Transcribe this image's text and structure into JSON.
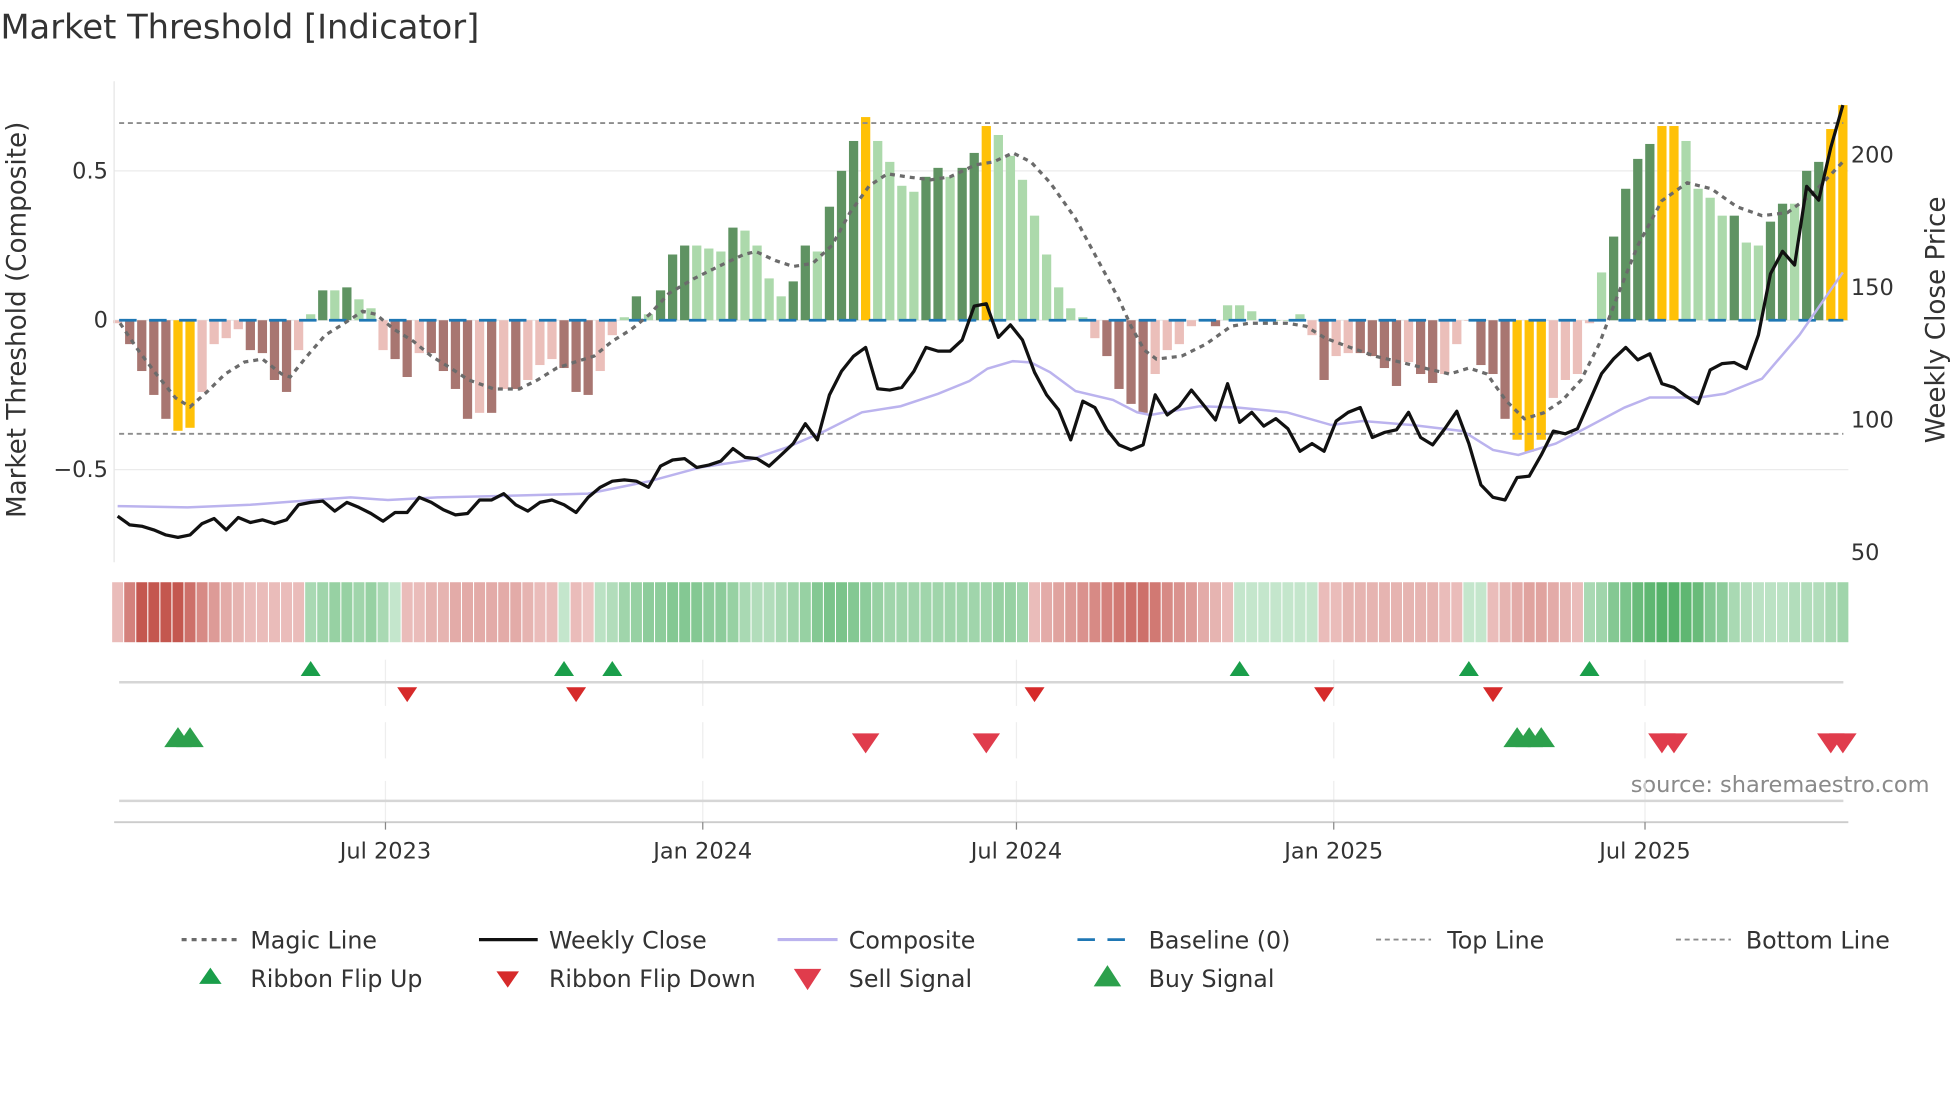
{
  "chart_data": {
    "type": "bar",
    "title": "Market Threshold [Indicator]",
    "ylabel": "Market Threshold (Composite)",
    "y2label": "Weekly Close Price",
    "source": "source: sharemaestro.com",
    "ylim": [
      -0.81,
      0.8
    ],
    "y2lim": [
      45.8,
      227.4
    ],
    "yticks": [
      {
        "value": 0.5,
        "label": "0.5"
      },
      {
        "value": 0,
        "label": "0"
      },
      {
        "value": -0.5,
        "label": "−0.5"
      }
    ],
    "y2ticks": [
      {
        "value": 200,
        "label": "200"
      },
      {
        "value": 150,
        "label": "150"
      },
      {
        "value": 100,
        "label": "100"
      },
      {
        "value": 50,
        "label": "50"
      }
    ],
    "xticks": [
      {
        "week": 22.2,
        "label": "Jul 2023"
      },
      {
        "week": 48.5,
        "label": "Jan 2024"
      },
      {
        "week": 74.5,
        "label": "Jul 2024"
      },
      {
        "week": 100.8,
        "label": "Jan 2025"
      },
      {
        "week": 126.6,
        "label": "Jul 2025"
      }
    ],
    "top_line": 0.66,
    "bottom_line": -0.38,
    "baseline": 0,
    "colors": {
      "G": "#5f9362",
      "g": "#acd9ab",
      "R": "#a87671",
      "r": "#ebbfba",
      "Y": "#ffc107",
      "magic": "#6b6b6b",
      "close": "#111111",
      "composite": "#bbb3ee",
      "baseline": "#1f77b4",
      "threshold": "#8c8c8c",
      "flip_up": "#1a9e4a",
      "flip_down": "#d62a2a",
      "buy": "#2ca04c",
      "sell": "#e03c4c"
    },
    "bars": [
      -0.01,
      -0.08,
      -0.17,
      -0.25,
      -0.33,
      -0.37,
      -0.36,
      -0.24,
      -0.08,
      -0.06,
      -0.03,
      -0.1,
      -0.11,
      -0.2,
      -0.24,
      -0.1,
      0.02,
      0.1,
      0.1,
      0.11,
      0.07,
      0.04,
      -0.1,
      -0.13,
      -0.19,
      -0.11,
      -0.11,
      -0.17,
      -0.23,
      -0.33,
      -0.31,
      -0.31,
      -0.23,
      -0.23,
      -0.2,
      -0.15,
      -0.13,
      -0.16,
      -0.24,
      -0.25,
      -0.17,
      -0.05,
      0.01,
      0.08,
      0.02,
      0.1,
      0.22,
      0.25,
      0.25,
      0.24,
      0.23,
      0.31,
      0.3,
      0.25,
      0.14,
      0.08,
      0.13,
      0.25,
      0.23,
      0.38,
      0.5,
      0.6,
      0.68,
      0.6,
      0.53,
      0.45,
      0.43,
      0.48,
      0.51,
      0.48,
      0.51,
      0.56,
      0.65,
      0.62,
      0.55,
      0.47,
      0.35,
      0.22,
      0.11,
      0.04,
      0.01,
      -0.06,
      -0.12,
      -0.23,
      -0.28,
      -0.31,
      -0.18,
      -0.1,
      -0.08,
      -0.02,
      0.0,
      -0.02,
      0.05,
      0.05,
      0.03,
      0.0,
      0.0,
      0.0,
      0.02,
      -0.05,
      -0.2,
      -0.12,
      -0.11,
      -0.11,
      -0.12,
      -0.16,
      -0.22,
      -0.14,
      -0.18,
      -0.21,
      -0.18,
      -0.08,
      0.0,
      -0.15,
      -0.18,
      -0.33,
      -0.4,
      -0.44,
      -0.4,
      -0.26,
      -0.2,
      -0.18,
      -0.01,
      0.16,
      0.28,
      0.44,
      0.54,
      0.59,
      0.65,
      0.65,
      0.6,
      0.44,
      0.41,
      0.35,
      0.35,
      0.26,
      0.25,
      0.33,
      0.39,
      0.39,
      0.5,
      0.53,
      0.64,
      0.72
    ],
    "bar_classes": "rRRRRYYrrrrRRRRrgGgGggrRRrRRRRrRrRrrrRRRrrgGgGGGgggGggggGGgGGGYggggGGgGGYggggggggrRRRRrrrrrRgggggggrRrrRRRRrRRrrrRRRYYYrrrrgGGGGYYggggGggGGgGGYY",
    "weekly_close": [
      63.2,
      59.9,
      59.4,
      58.0,
      56.1,
      55.2,
      56.1,
      60.4,
      62.3,
      58.0,
      62.7,
      60.8,
      61.8,
      60.4,
      61.8,
      67.5,
      68.4,
      68.9,
      65.1,
      68.4,
      66.5,
      64.2,
      61.3,
      64.6,
      64.6,
      70.3,
      68.4,
      65.6,
      63.7,
      64.2,
      69.3,
      69.3,
      71.7,
      67.5,
      65.1,
      68.4,
      69.3,
      67.5,
      64.6,
      70.3,
      74.1,
      76.4,
      76.9,
      76.4,
      74.1,
      82.1,
      84.4,
      84.9,
      81.6,
      82.5,
      84.0,
      88.7,
      85.4,
      84.9,
      82.1,
      86.3,
      90.6,
      98.1,
      92.0,
      109.0,
      117.9,
      123.6,
      126.9,
      111.3,
      110.8,
      111.8,
      117.9,
      126.9,
      125.5,
      125.5,
      129.7,
      142.5,
      143.4,
      130.7,
      135.4,
      129.7,
      117.5,
      109.0,
      103.3,
      92.0,
      106.6,
      104.2,
      95.8,
      90.1,
      88.2,
      90.1,
      109.0,
      101.4,
      104.7,
      110.8,
      105.2,
      99.5,
      113.2,
      98.6,
      102.4,
      97.2,
      100.0,
      96.2,
      87.7,
      90.6,
      87.7,
      99.1,
      102.4,
      104.2,
      92.9,
      94.8,
      95.8,
      102.4,
      92.9,
      90.1,
      96.2,
      102.8,
      90.6,
      75.0,
      70.3,
      69.3,
      77.8,
      78.3,
      86.3,
      95.3,
      94.3,
      96.2,
      106.6,
      117.0,
      122.6,
      126.9,
      122.2,
      124.5,
      113.2,
      111.8,
      108.5,
      105.7,
      118.4,
      120.8,
      121.2,
      118.9,
      131.6,
      154.7,
      163.2,
      158.0,
      187.7,
      182.5,
      202.4,
      218.4
    ],
    "composite": [
      [
        0,
        67.0
      ],
      [
        5.8,
        66.5
      ],
      [
        11,
        67.5
      ],
      [
        16.2,
        69.3
      ],
      [
        19.3,
        70.3
      ],
      [
        22.4,
        69.3
      ],
      [
        26.5,
        70.3
      ],
      [
        31.7,
        70.8
      ],
      [
        39,
        71.7
      ],
      [
        44.1,
        76.4
      ],
      [
        48.3,
        81.6
      ],
      [
        52.4,
        84.4
      ],
      [
        55.5,
        89.2
      ],
      [
        58.6,
        95.3
      ],
      [
        61.7,
        102.4
      ],
      [
        64.9,
        104.7
      ],
      [
        68,
        109.4
      ],
      [
        70.6,
        114.2
      ],
      [
        72.1,
        118.9
      ],
      [
        74.2,
        121.7
      ],
      [
        75.7,
        121.2
      ],
      [
        77.3,
        117.5
      ],
      [
        79.4,
        110.4
      ],
      [
        82.5,
        107.1
      ],
      [
        84.5,
        102.4
      ],
      [
        85.6,
        101.4
      ],
      [
        89.7,
        104.7
      ],
      [
        92.8,
        104.2
      ],
      [
        96.9,
        102.4
      ],
      [
        100.6,
        97.6
      ],
      [
        103.2,
        99.1
      ],
      [
        107.3,
        97.6
      ],
      [
        111.5,
        95.3
      ],
      [
        114,
        88.2
      ],
      [
        116.1,
        86.3
      ],
      [
        119.2,
        90.6
      ],
      [
        121.8,
        96.7
      ],
      [
        124.9,
        104.2
      ],
      [
        127,
        108.0
      ],
      [
        131.1,
        108.0
      ],
      [
        133.2,
        109.4
      ],
      [
        136.3,
        115.1
      ],
      [
        139.4,
        131.6
      ],
      [
        143,
        155.2
      ]
    ],
    "magic_line": [
      [
        0.2,
        -0.01
      ],
      [
        1.7,
        -0.1
      ],
      [
        3.2,
        -0.18
      ],
      [
        4.8,
        -0.26
      ],
      [
        6.0,
        -0.29
      ],
      [
        7.4,
        -0.24
      ],
      [
        8.9,
        -0.18
      ],
      [
        10.5,
        -0.14
      ],
      [
        12.0,
        -0.13
      ],
      [
        13.6,
        -0.18
      ],
      [
        14.3,
        -0.19
      ],
      [
        15.7,
        -0.12
      ],
      [
        17.2,
        -0.05
      ],
      [
        18.8,
        -0.01
      ],
      [
        20.3,
        0.03
      ],
      [
        21.4,
        0.02
      ],
      [
        22.9,
        -0.03
      ],
      [
        24.5,
        -0.07
      ],
      [
        26.0,
        -0.12
      ],
      [
        27.6,
        -0.16
      ],
      [
        29.1,
        -0.2
      ],
      [
        31.2,
        -0.23
      ],
      [
        33.3,
        -0.23
      ],
      [
        34.8,
        -0.2
      ],
      [
        36.4,
        -0.16
      ],
      [
        37.9,
        -0.14
      ],
      [
        39.5,
        -0.12
      ],
      [
        41.0,
        -0.07
      ],
      [
        42.6,
        -0.03
      ],
      [
        44.1,
        0.02
      ],
      [
        45.7,
        0.09
      ],
      [
        47.8,
        0.14
      ],
      [
        49.8,
        0.18
      ],
      [
        51.9,
        0.22
      ],
      [
        52.9,
        0.23
      ],
      [
        54.5,
        0.2
      ],
      [
        56.0,
        0.18
      ],
      [
        57.6,
        0.19
      ],
      [
        59.2,
        0.25
      ],
      [
        60.7,
        0.36
      ],
      [
        62.3,
        0.45
      ],
      [
        63.8,
        0.49
      ],
      [
        65.4,
        0.48
      ],
      [
        67.4,
        0.47
      ],
      [
        69.0,
        0.48
      ],
      [
        71.1,
        0.52
      ],
      [
        72.6,
        0.53
      ],
      [
        74.2,
        0.56
      ],
      [
        75.7,
        0.53
      ],
      [
        77.3,
        0.46
      ],
      [
        79.4,
        0.34
      ],
      [
        81.4,
        0.19
      ],
      [
        83.0,
        0.07
      ],
      [
        84.0,
        -0.02
      ],
      [
        85.1,
        -0.1
      ],
      [
        86.1,
        -0.13
      ],
      [
        88.2,
        -0.12
      ],
      [
        90.2,
        -0.08
      ],
      [
        92.3,
        -0.02
      ],
      [
        93.8,
        -0.01
      ],
      [
        96.9,
        -0.01
      ],
      [
        98.5,
        -0.02
      ],
      [
        100.1,
        -0.06
      ],
      [
        102.1,
        -0.09
      ],
      [
        104.2,
        -0.12
      ],
      [
        106.3,
        -0.14
      ],
      [
        108.3,
        -0.16
      ],
      [
        110.4,
        -0.18
      ],
      [
        112.0,
        -0.16
      ],
      [
        113.5,
        -0.18
      ],
      [
        115.1,
        -0.27
      ],
      [
        116.6,
        -0.33
      ],
      [
        118.2,
        -0.31
      ],
      [
        119.7,
        -0.27
      ],
      [
        121.3,
        -0.2
      ],
      [
        122.8,
        -0.08
      ],
      [
        124.4,
        0.09
      ],
      [
        126.0,
        0.25
      ],
      [
        128.0,
        0.4
      ],
      [
        130.1,
        0.46
      ],
      [
        132.1,
        0.44
      ],
      [
        134.2,
        0.38
      ],
      [
        136.3,
        0.35
      ],
      [
        138.4,
        0.36
      ],
      [
        140.4,
        0.42
      ],
      [
        143.0,
        0.53
      ]
    ],
    "ribbon": [
      -0.2,
      -0.55,
      -0.8,
      -0.8,
      -0.8,
      -0.8,
      -0.65,
      -0.5,
      -0.4,
      -0.3,
      -0.25,
      -0.2,
      -0.2,
      -0.2,
      -0.2,
      -0.2,
      0.3,
      0.35,
      0.4,
      0.4,
      0.35,
      0.4,
      0.3,
      0.15,
      -0.2,
      -0.2,
      -0.25,
      -0.25,
      -0.3,
      -0.3,
      -0.3,
      -0.3,
      -0.3,
      -0.3,
      -0.25,
      -0.2,
      -0.2,
      0.15,
      -0.2,
      -0.15,
      0.2,
      0.25,
      0.35,
      0.4,
      0.45,
      0.45,
      0.5,
      0.5,
      0.5,
      0.45,
      0.45,
      0.4,
      0.3,
      0.25,
      0.25,
      0.3,
      0.35,
      0.4,
      0.5,
      0.55,
      0.55,
      0.5,
      0.45,
      0.4,
      0.35,
      0.35,
      0.35,
      0.35,
      0.35,
      0.35,
      0.35,
      0.35,
      0.35,
      0.4,
      0.4,
      0.35,
      -0.2,
      -0.3,
      -0.35,
      -0.4,
      -0.45,
      -0.5,
      -0.55,
      -0.6,
      -0.65,
      -0.65,
      -0.6,
      -0.5,
      -0.45,
      -0.4,
      -0.3,
      -0.25,
      -0.2,
      0.15,
      0.15,
      0.15,
      0.15,
      0.15,
      0.15,
      0.15,
      -0.2,
      -0.2,
      -0.25,
      -0.25,
      -0.25,
      -0.25,
      -0.25,
      -0.25,
      -0.25,
      -0.25,
      -0.2,
      -0.2,
      0.15,
      0.15,
      -0.2,
      -0.25,
      -0.3,
      -0.35,
      -0.35,
      -0.3,
      -0.25,
      -0.2,
      0.3,
      0.35,
      0.5,
      0.55,
      0.65,
      0.7,
      0.75,
      0.75,
      0.7,
      0.65,
      0.5,
      0.45,
      0.3,
      0.25,
      0.2,
      0.2,
      0.2,
      0.25,
      0.25,
      0.25,
      0.3,
      0.35
    ],
    "ribbon_flip_up": [
      16,
      37,
      41,
      93,
      112,
      122
    ],
    "ribbon_flip_down": [
      24,
      38,
      76,
      100,
      114
    ],
    "buy_signals": [
      5,
      6,
      116,
      117,
      118
    ],
    "sell_signals": [
      62,
      72,
      128,
      129,
      142,
      143
    ],
    "legend": [
      {
        "label": "Magic Line",
        "symbol": "dotted-line"
      },
      {
        "label": "Weekly Close",
        "symbol": "solid-line"
      },
      {
        "label": "Composite",
        "symbol": "lavender-line"
      },
      {
        "label": "Baseline (0)",
        "symbol": "dashed-line"
      },
      {
        "label": "Top Line",
        "symbol": "thin-dashed-line"
      },
      {
        "label": "Bottom Line",
        "symbol": "thin-dashed-line"
      },
      {
        "label": "Ribbon Flip Up",
        "symbol": "triangle-up-small"
      },
      {
        "label": "Ribbon Flip Down",
        "symbol": "triangle-down-small"
      },
      {
        "label": "Sell Signal",
        "symbol": "triangle-down-large"
      },
      {
        "label": "Buy Signal",
        "symbol": "triangle-up-large"
      }
    ]
  }
}
